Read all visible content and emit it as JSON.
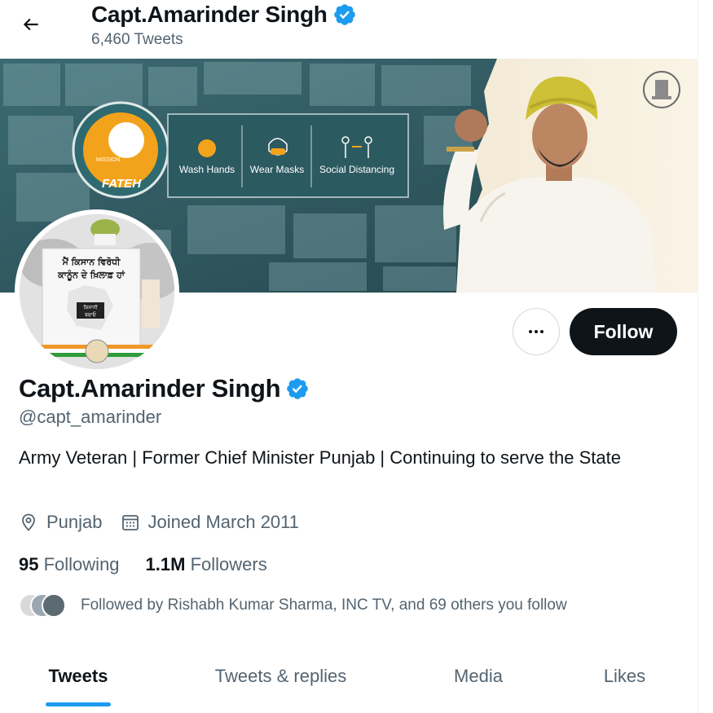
{
  "header": {
    "name": "Capt.Amarinder Singh",
    "tweet_count": "6,460 Tweets"
  },
  "banner": {
    "campaign": "FATEH",
    "mission": "MISSION",
    "wash": "Wash Hands",
    "masks": "Wear Masks",
    "distancing": "Social Distancing"
  },
  "avatar": {
    "placard_line1": "ਮੈਂ ਕਿਸਾਨ ਵਿਰੋਧੀ",
    "placard_line2": "ਕਾਨੂੰਨ ਦੇ ਖ਼ਿਲਾਫ਼ ਹਾਂ",
    "badge_line1": "ਕਿਸਾਨੀ",
    "badge_line2": "ਬਚਾਓ"
  },
  "actions": {
    "follow_label": "Follow"
  },
  "profile": {
    "name": "Capt.Amarinder Singh",
    "handle": "@capt_amarinder",
    "bio": "Army Veteran | Former Chief Minister Punjab | Continuing to serve the State",
    "location": "Punjab",
    "joined": "Joined March 2011",
    "following_count": "95",
    "following_label": "Following",
    "followers_count": "1.1M",
    "followers_label": "Followers",
    "followed_by": "Followed by Rishabh Kumar Sharma, INC TV, and 69 others you follow"
  },
  "tabs": [
    {
      "label": "Tweets",
      "active": true
    },
    {
      "label": "Tweets & replies",
      "active": false
    },
    {
      "label": "Media",
      "active": false
    },
    {
      "label": "Likes",
      "active": false
    }
  ],
  "colors": {
    "accent": "#1d9bf0",
    "verified": "#1d9bf0",
    "text_primary": "#0f1419",
    "text_secondary": "#536471",
    "follow_bg": "#0f1419"
  },
  "icons": {
    "back": "arrow-left-icon",
    "verified": "verified-badge-icon",
    "more": "more-horizontal-icon",
    "location": "location-pin-icon",
    "calendar": "calendar-icon"
  }
}
